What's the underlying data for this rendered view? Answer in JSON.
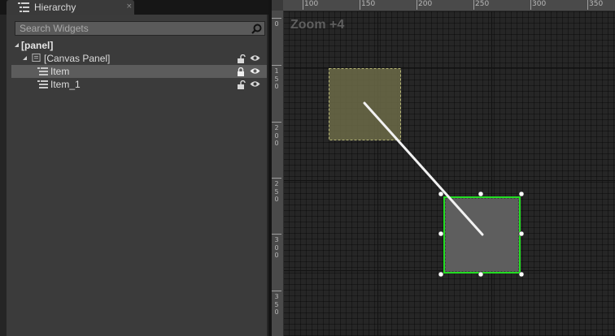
{
  "hierarchy_tab": {
    "title": "Hierarchy",
    "close": "×"
  },
  "search": {
    "placeholder": "Search Widgets",
    "value": ""
  },
  "tree": {
    "root": "[panel]",
    "canvas_panel": "[Canvas Panel]",
    "items": [
      {
        "label": "Item",
        "selected": true,
        "lock": "locked"
      },
      {
        "label": "Item_1",
        "selected": false,
        "lock": "unlocked"
      }
    ]
  },
  "canvas": {
    "zoom_label": "Zoom +4",
    "ruler_top": [
      "100",
      "150",
      "200",
      "250",
      "300",
      "350"
    ],
    "ruler_left": [
      [
        "0"
      ],
      [
        "1",
        "5",
        "0"
      ],
      [
        "2",
        "0",
        "0"
      ],
      [
        "2",
        "5",
        "0"
      ],
      [
        "3",
        "0",
        "0"
      ],
      [
        "3",
        "5",
        "0"
      ]
    ]
  },
  "colors": {
    "selection_outline": "#22dd22",
    "ghost_fill": "#6c6b48",
    "ghost_border": "#b8b878",
    "item_fill": "#5e5e5e"
  }
}
